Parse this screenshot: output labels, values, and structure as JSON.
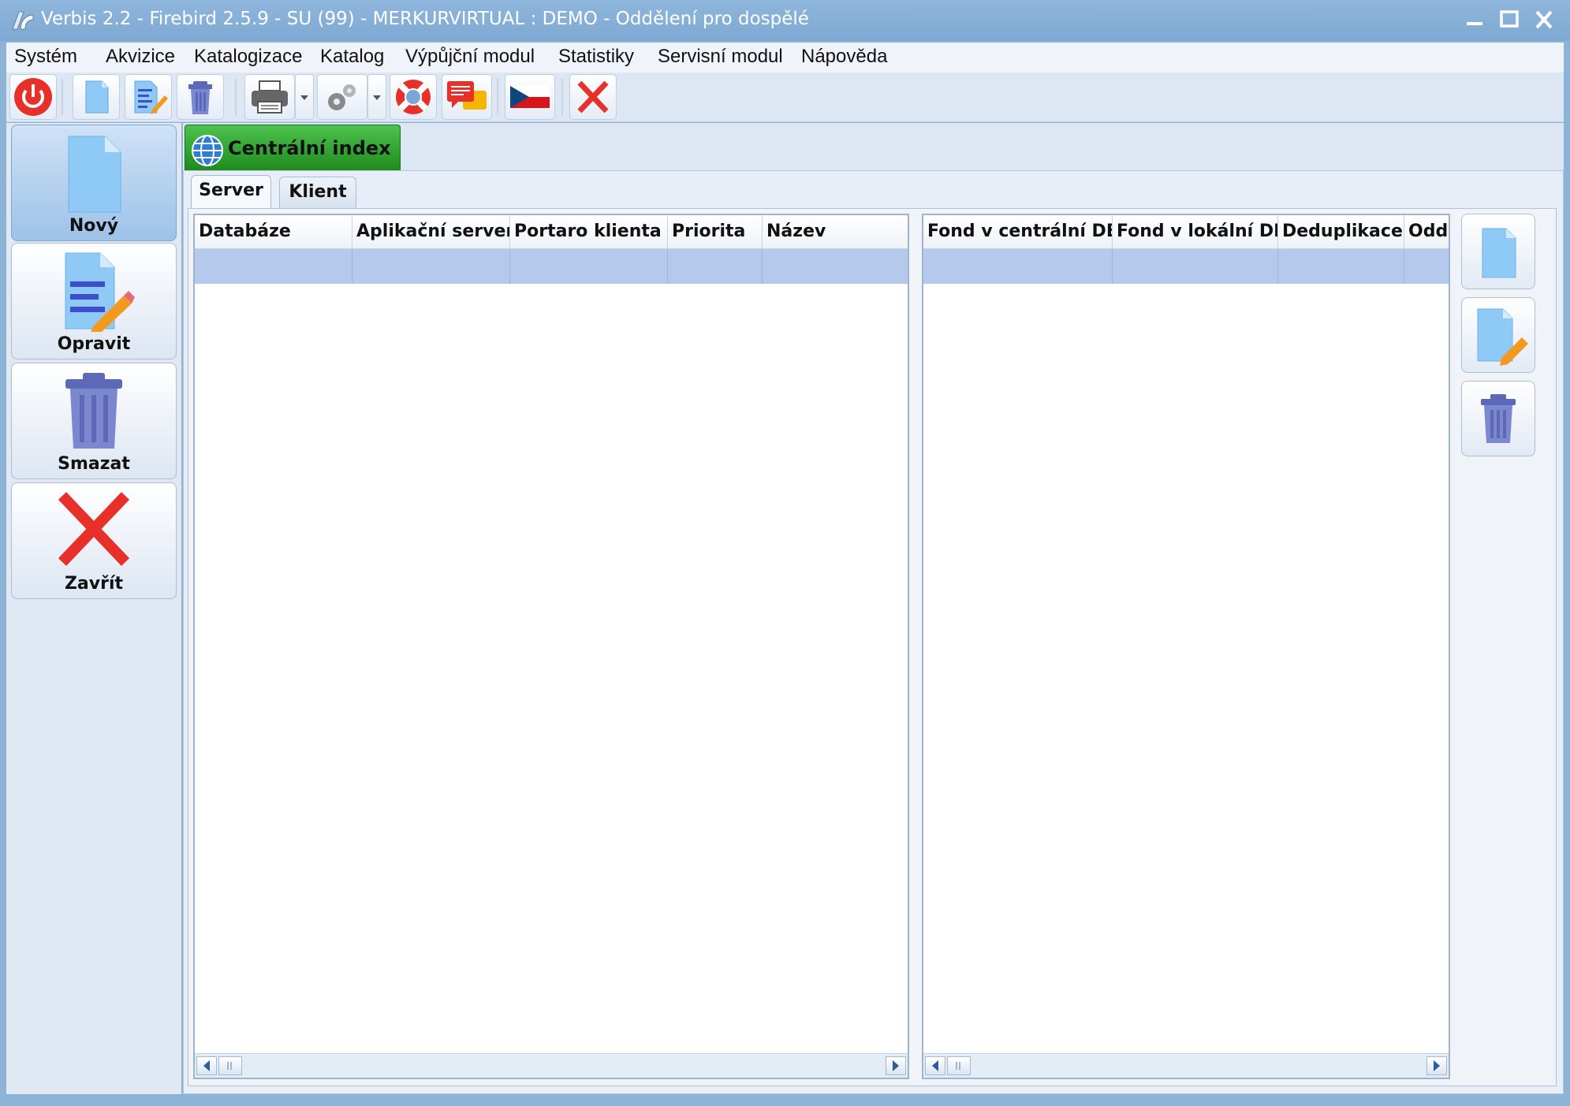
{
  "window": {
    "title": "Verbis 2.2 - Firebird 2.5.9 - SU (99) - MERKURVIRTUAL : DEMO - Oddělení pro dospělé"
  },
  "menu": {
    "items": [
      "Systém",
      "Akvizice",
      "Katalogizace",
      "Katalog",
      "Výpůjční modul",
      "Statistiky",
      "Servisní modul",
      "Nápověda"
    ]
  },
  "toolbar": {
    "icons": [
      "power-icon",
      "new-document-icon",
      "edit-document-icon",
      "trash-icon",
      "printer-icon",
      "settings-gear-icon",
      "help-lifebuoy-icon",
      "chat-messages-icon",
      "czech-flag-icon",
      "close-x-icon"
    ]
  },
  "leftpanel": {
    "new_label": "Nový",
    "edit_label": "Opravit",
    "delete_label": "Smazat",
    "close_label": "Zavřít"
  },
  "main_tab": {
    "label": "Centrální index"
  },
  "subtabs": {
    "server": "Server",
    "client": "Klient"
  },
  "left_grid": {
    "columns": [
      "Databáze",
      "Aplikační server",
      "Portaro klienta",
      "Priorita",
      "Název"
    ]
  },
  "right_grid": {
    "columns": [
      "Fond v centrální DB",
      "Fond v lokální DB",
      "Deduplikace",
      "Oddě"
    ]
  },
  "colors": {
    "accent_green": "#1e8a1e",
    "selected_row": "#b4c9eb",
    "title_bar": "#7ea9d2"
  }
}
